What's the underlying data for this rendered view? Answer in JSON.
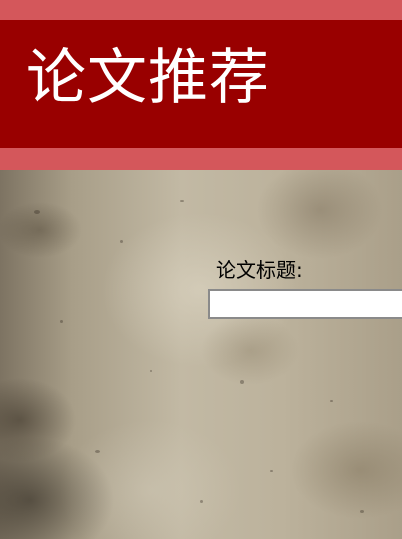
{
  "header": {
    "title": "论文推荐"
  },
  "form": {
    "title_label": "论文标题:",
    "title_input_value": "",
    "title_input_placeholder": ""
  },
  "colors": {
    "header_band": "#990000",
    "header_stripe": "#d4575b",
    "title_text": "#ffffff",
    "label_text": "#000000"
  }
}
